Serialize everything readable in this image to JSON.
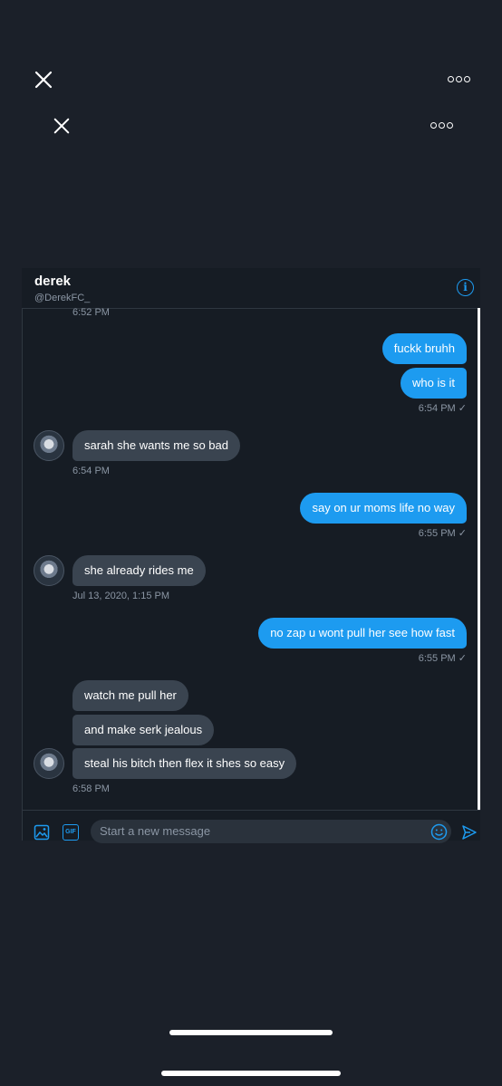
{
  "outer_toolbar": {
    "close_icon": "close-icon",
    "more_icon": "more-icon"
  },
  "inner_toolbar": {
    "close_icon": "close-icon",
    "more_icon": "more-icon"
  },
  "conversation_header": {
    "name": "derek",
    "handle": "@DerekFC_",
    "info_icon": "info-icon",
    "info_glyph": "i"
  },
  "messages": [
    {
      "type": "timestamp",
      "text": "6:52 PM"
    },
    {
      "type": "sent",
      "text": "fuckk bruhh"
    },
    {
      "type": "sent",
      "text": "who is it"
    },
    {
      "type": "timestamp",
      "text": "6:54 PM ✓"
    },
    {
      "type": "received",
      "text": "sarah she wants me so bad"
    },
    {
      "type": "timestamp",
      "text": "6:54 PM"
    },
    {
      "type": "sent",
      "text": "say on ur moms life no way"
    },
    {
      "type": "timestamp",
      "text": "6:55 PM ✓"
    },
    {
      "type": "received",
      "text": "she already rides me"
    },
    {
      "type": "timestamp",
      "text": "Jul 13, 2020, 1:15 PM"
    },
    {
      "type": "sent",
      "text": "no zap u wont pull her see how fast"
    },
    {
      "type": "timestamp",
      "text": "6:55 PM ✓"
    },
    {
      "type": "received",
      "text": "watch me pull her"
    },
    {
      "type": "received",
      "text": "and make serk jealous"
    },
    {
      "type": "received",
      "text": "steal his bitch then flex it shes so easy"
    },
    {
      "type": "timestamp",
      "text": "6:58 PM"
    }
  ],
  "composer": {
    "placeholder": "Start a new message",
    "image_icon": "image-icon",
    "gif_icon": "gif-icon",
    "gif_label": "GIF",
    "emoji_icon": "emoji-icon",
    "send_icon": "send-icon"
  },
  "colors": {
    "background": "#1b2029",
    "sent_bubble": "#1d9bf0",
    "received_bubble": "#3a4450",
    "accent": "#1d9bf0"
  }
}
